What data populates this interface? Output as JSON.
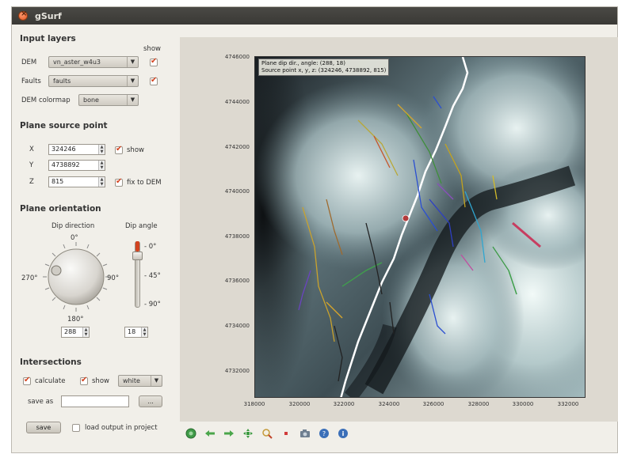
{
  "window": {
    "title": "gSurf"
  },
  "input_layers": {
    "title": "Input layers",
    "show_header": "show",
    "dem_label": "DEM",
    "dem_value": "vn_aster_w4u3",
    "faults_label": "Faults",
    "faults_value": "faults",
    "colormap_label": "DEM colormap",
    "colormap_value": "bone",
    "dem_show": true,
    "faults_show": true
  },
  "source_point": {
    "title": "Plane source point",
    "x_label": "X",
    "x_value": "324246",
    "y_label": "Y",
    "y_value": "4738892",
    "z_label": "Z",
    "z_value": "815",
    "show_label": "show",
    "fix_label": "fix to DEM"
  },
  "orientation": {
    "title": "Plane orientation",
    "dip_dir_label": "Dip direction",
    "dip_angle_label": "Dip angle",
    "dial_n": "0°",
    "dial_e": "90°",
    "dial_s": "180°",
    "dial_w": "270°",
    "dip_dir_value": "288",
    "dip_angle_value": "18",
    "slider_ticks": [
      "- 0°",
      "- 45°",
      "- 90°"
    ]
  },
  "intersections": {
    "title": "Intersections",
    "calculate_label": "calculate",
    "show_label": "show",
    "color_value": "white",
    "save_as_label": "save as",
    "browse_label": "...",
    "save_button": "save",
    "load_label": "load output in project"
  },
  "map": {
    "info_line1": "Plane dip dir., angle: (288, 18)",
    "info_line2": "Source point x, y, z: (324246, 4738892, 815)",
    "y_ticks": [
      "4746000",
      "4744000",
      "4742000",
      "4740000",
      "4738000",
      "4736000",
      "4734000",
      "4732000"
    ],
    "x_ticks": [
      "318000",
      "320000",
      "322000",
      "324000",
      "326000",
      "328000",
      "330000",
      "332000"
    ]
  },
  "toolbar": {
    "icons": [
      "home-icon",
      "back-icon",
      "forward-icon",
      "pan-icon",
      "zoom-icon",
      "subplots-icon",
      "save-figure-icon",
      "help-icon",
      "info-icon"
    ]
  },
  "colors": {
    "accent_check": "#d3431f",
    "map_dark": "#111418",
    "map_light": "#dfeeee"
  }
}
